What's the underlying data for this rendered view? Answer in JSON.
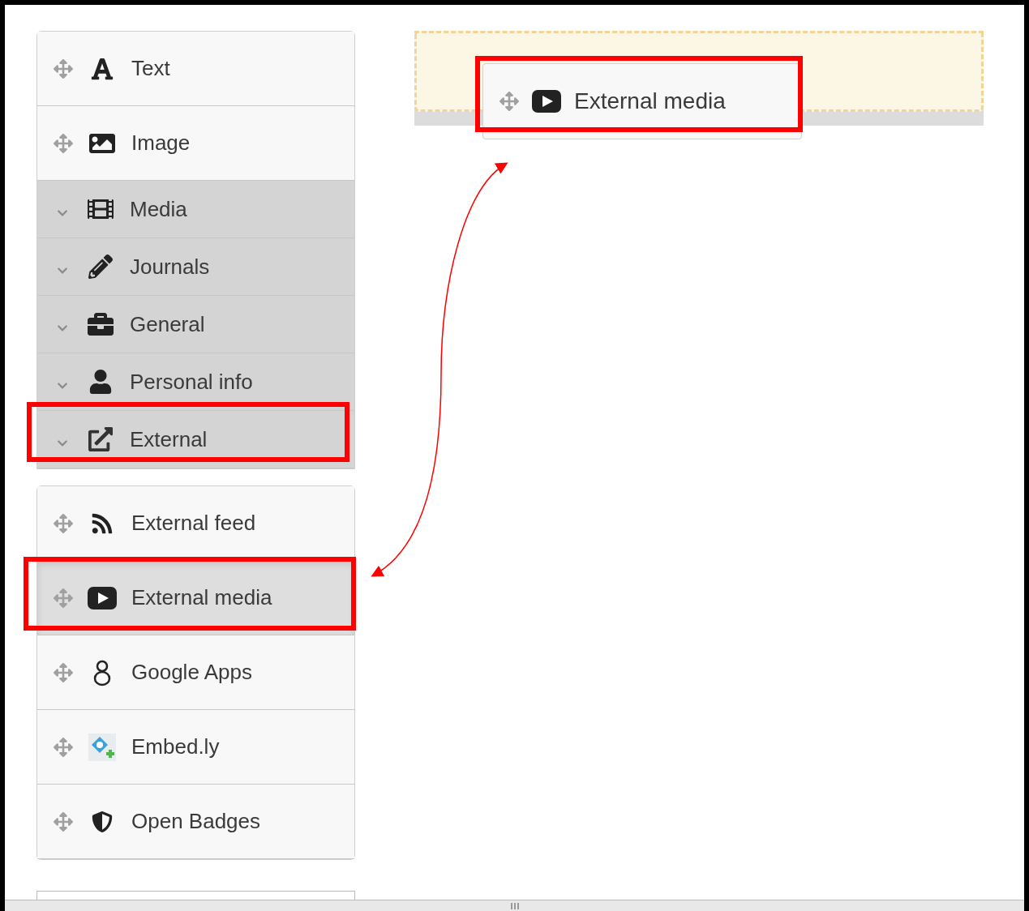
{
  "blocks": [
    {
      "label": "Text",
      "selected": false,
      "annotated": false
    },
    {
      "label": "Image",
      "selected": false,
      "annotated": false
    }
  ],
  "categories": [
    {
      "label": "Media",
      "annotated": false
    },
    {
      "label": "Journals",
      "annotated": false
    },
    {
      "label": "General",
      "annotated": false
    },
    {
      "label": "Personal info",
      "annotated": false
    },
    {
      "label": "External",
      "annotated": true
    }
  ],
  "external_blocks": [
    {
      "label": "External feed",
      "selected": false,
      "annotated": false
    },
    {
      "label": "External media",
      "selected": true,
      "annotated": true
    },
    {
      "label": "Google Apps",
      "selected": false,
      "annotated": false
    },
    {
      "label": "Embed.ly",
      "selected": false,
      "annotated": false
    },
    {
      "label": "Open Badges",
      "selected": false,
      "annotated": false
    }
  ],
  "drop_zone": {
    "dragged_block": {
      "label": "External media",
      "annotated": true
    }
  }
}
